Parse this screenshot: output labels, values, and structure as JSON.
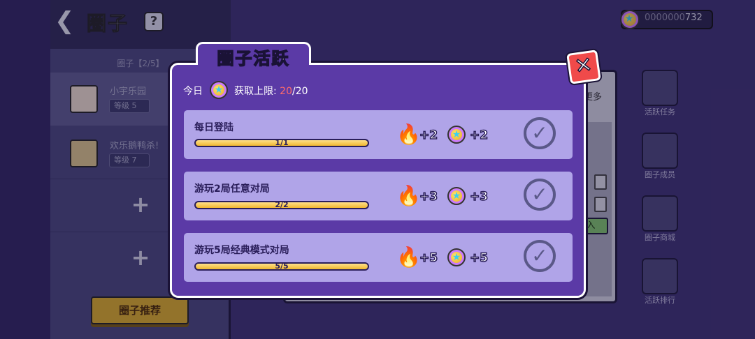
{
  "left_panel": {
    "title": "圈子",
    "help_label": "?",
    "club_count": "圈子【2/5】",
    "clubs": [
      {
        "name": "小宇乐园",
        "level": "等级  5"
      },
      {
        "name": "欢乐鹅鸭杀!",
        "level": "等级  7"
      }
    ],
    "add_label": "+",
    "recommend_button": "圈子推荐"
  },
  "currency": {
    "prefix": "0000000",
    "value": "732"
  },
  "side_menu": [
    {
      "label": "活跃任务",
      "icon": "flame-icon"
    },
    {
      "label": "圈子成员",
      "icon": "members-icon"
    },
    {
      "label": "圈子商城",
      "icon": "cart-icon"
    },
    {
      "label": "活跃排行",
      "icon": "podium-icon"
    }
  ],
  "background_panel": {
    "more_label": "更多",
    "join_label": "入"
  },
  "modal": {
    "tab_title": "圈子活跃",
    "close_label": "✕",
    "today_label": "今日",
    "limit_label": "获取上限:",
    "limit_current": "20",
    "limit_max": "/20",
    "tasks": [
      {
        "name": "每日登陆",
        "progress_text": "1/1",
        "progress": 1.0,
        "fire_reward": "+2",
        "coin_reward": "+2",
        "completed": true
      },
      {
        "name": "游玩2局任意对局",
        "progress_text": "2/2",
        "progress": 1.0,
        "fire_reward": "+3",
        "coin_reward": "+3",
        "completed": true
      },
      {
        "name": "游玩5局经典模式对局",
        "progress_text": "5/5",
        "progress": 1.0,
        "fire_reward": "+5",
        "coin_reward": "+5",
        "completed": true
      }
    ]
  },
  "colors": {
    "modal_bg": "#5b3aa6",
    "task_bg": "#b0a4e8",
    "progress_fill": "#f0b830",
    "close_button": "#f04a4a",
    "limit_current": "#ff6b6b"
  }
}
